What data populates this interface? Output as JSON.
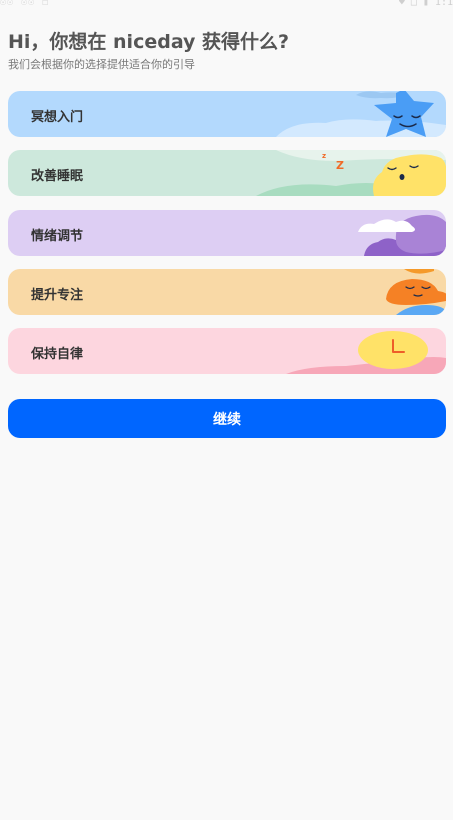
{
  "status_bar": {
    "left_text": "☉☉ ☉☉ ☐",
    "right_text": "♥ □ ▮ 1:1"
  },
  "header": {
    "title": "Hi，你想在 niceday 获得什么?",
    "subtitle": "我们会根据你的选择提供适合你的引导"
  },
  "options": [
    {
      "label": "冥想入门",
      "bg_color": "#b3d9fd",
      "icon": "sleeping-star-icon"
    },
    {
      "label": "改善睡眠",
      "bg_color": "#cde8dc",
      "icon": "sleeping-moon-icon"
    },
    {
      "label": "情绪调节",
      "bg_color": "#ddcef3",
      "icon": "purple-cloud-icon"
    },
    {
      "label": "提升专注",
      "bg_color": "#f9d9a6",
      "icon": "orange-cloud-icon"
    },
    {
      "label": "保持自律",
      "bg_color": "#fdd6df",
      "icon": "clock-face-icon"
    }
  ],
  "continue_button": {
    "label": "继续",
    "color": "#0066ff"
  }
}
